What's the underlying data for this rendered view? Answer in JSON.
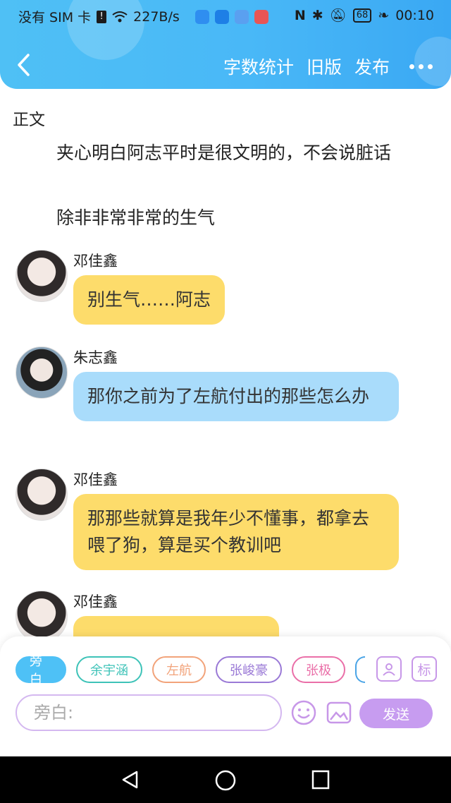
{
  "status_bar": {
    "carrier": "没有 SIM 卡",
    "speed": "227B/s",
    "battery": "68",
    "time": "00:10",
    "icon_names": [
      "sim-alert-icon",
      "wifi-icon",
      "weather-icon",
      "bulb-icon",
      "cloud-icon",
      "book-icon",
      "nfc-icon",
      "bluetooth-icon",
      "mute-icon",
      "battery-icon",
      "leaf-icon"
    ]
  },
  "header": {
    "actions": [
      "字数统计",
      "旧版",
      "发布"
    ]
  },
  "content": {
    "section_label": "正文",
    "paragraphs": [
      "夹心明白阿志平时是很文明的，不会说脏话",
      "除非非常非常的生气"
    ],
    "messages": [
      {
        "speaker": "邓佳鑫",
        "text": "别生气……阿志",
        "color": "#fddc6b"
      },
      {
        "speaker": "朱志鑫",
        "text": "那你之前为了左航付出的那些怎么办",
        "color": "#a9dcfb"
      },
      {
        "speaker": "邓佳鑫",
        "text": "那那些就算是我年少不懂事，都拿去喂了狗，算是买个教训吧",
        "color": "#fddc6b"
      },
      {
        "speaker": "邓佳鑫",
        "text": "",
        "color": "#fddc6b"
      }
    ]
  },
  "input_panel": {
    "roles": [
      "旁白",
      "余宇涵",
      "左航",
      "张峻豪",
      "张极"
    ],
    "placeholder": "旁白:",
    "send_label": "发送",
    "tag_label": "标"
  },
  "colors": {
    "accent": "#4ec1f6",
    "send": "#c79cf0"
  }
}
